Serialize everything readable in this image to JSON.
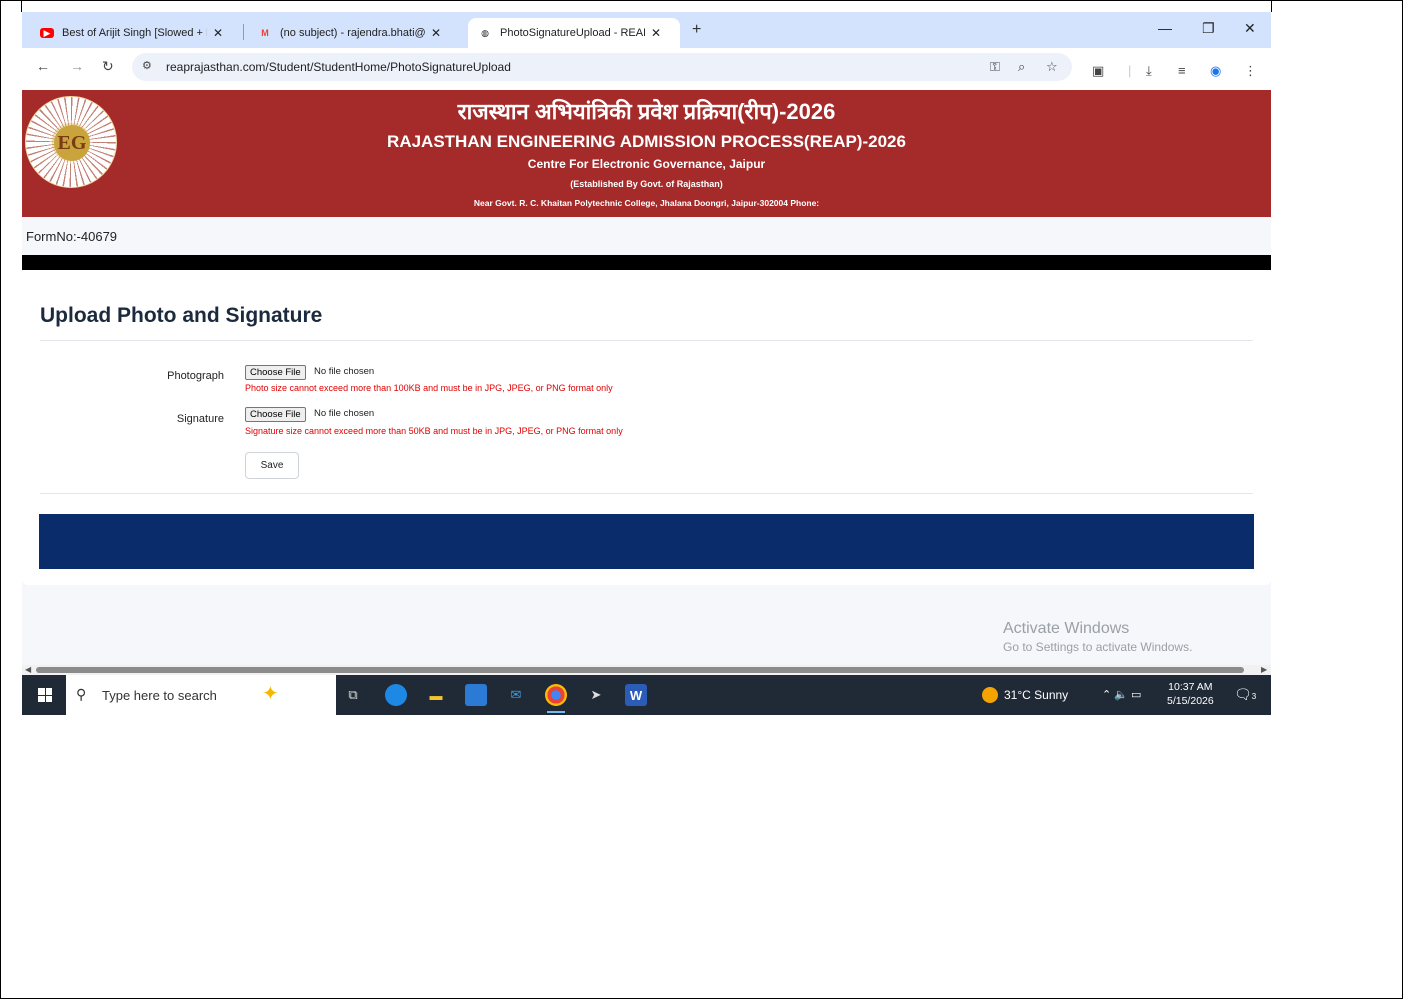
{
  "browser": {
    "tabs": [
      {
        "title": "Best of Arijit Singh [Slowed + R",
        "favicon": "youtube-icon",
        "color": "#ff0000"
      },
      {
        "title": "(no subject) - rajendra.bhati@s",
        "favicon": "gmail-icon",
        "color": "#ea4335"
      },
      {
        "title": "PhotoSignatureUpload - REAP-",
        "favicon": "globe-icon",
        "color": "#444444"
      }
    ],
    "new_tab": "+",
    "url": "reaprajasthan.com/Student/StudentHome/PhotoSignatureUpload"
  },
  "header": {
    "hindi_title": "राजस्थान अभियांत्रिकी प्रवेश प्रक्रिया(रीप)-2026",
    "english_title": "RAJASTHAN ENGINEERING ADMISSION PROCESS(REAP)-2026",
    "centre": "Centre For Electronic Governance, Jaipur",
    "established": "(Established By Govt. of Rajasthan)",
    "address": "Near Govt. R. C. Khaitan Polytechnic College, Jhalana Doongri, Jaipur-302004 Phone:",
    "logo_text": "EG",
    "bg_color": "#a52a2a"
  },
  "form_no": "FormNo:-40679",
  "upload": {
    "heading": "Upload Photo and Signature",
    "photograph": {
      "label": "Photograph",
      "button": "Choose File",
      "status": "No file chosen",
      "note": "Photo size cannot exceed more than 100KB and must be in JPG, JPEG, or PNG format only"
    },
    "signature": {
      "label": "Signature",
      "button": "Choose File",
      "status": "No file chosen",
      "note": "Signature size cannot exceed more than 50KB and must be in JPG, JPEG, or PNG format only"
    },
    "save_label": "Save"
  },
  "watermark": {
    "line1": "Activate Windows",
    "line2": "Go to Settings to activate Windows."
  },
  "taskbar": {
    "search_placeholder": "Type here to search",
    "weather": "31°C  Sunny",
    "time": "10:37 AM",
    "date": "5/15/2026",
    "notification_count": "3"
  }
}
